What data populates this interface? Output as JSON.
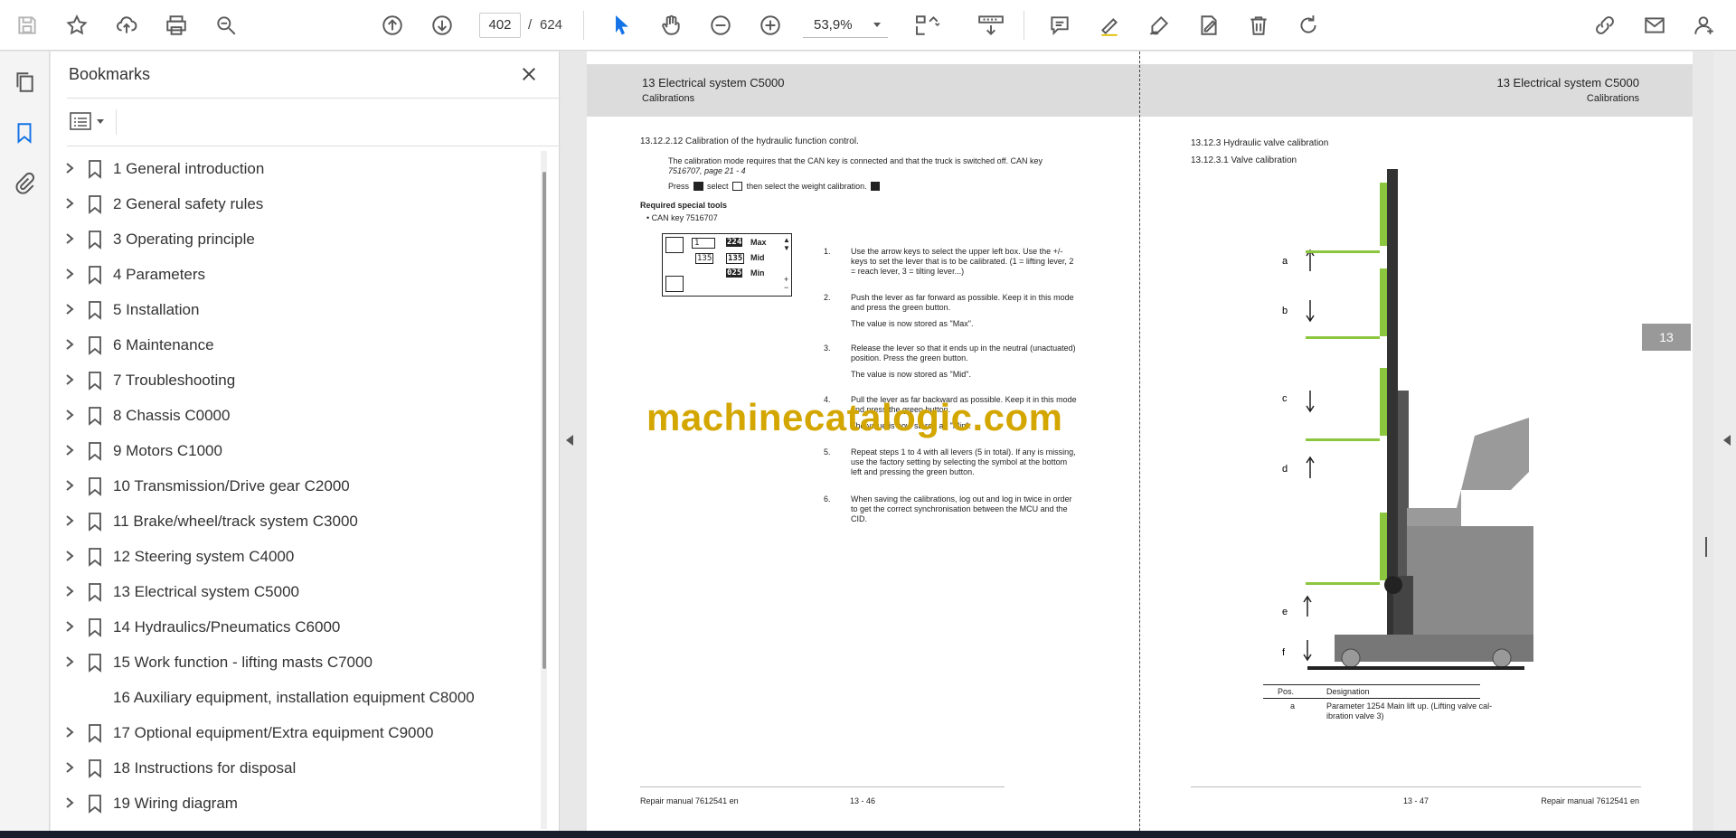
{
  "toolbar": {
    "current_page": "402",
    "page_sep": "/",
    "total_pages": "624",
    "zoom": "53,9%"
  },
  "panel": {
    "title": "Bookmarks",
    "bookmarks": [
      {
        "label": "1 General introduction",
        "expandable": true
      },
      {
        "label": "2 General safety rules",
        "expandable": true
      },
      {
        "label": "3 Operating principle",
        "expandable": true
      },
      {
        "label": "4 Parameters",
        "expandable": true
      },
      {
        "label": "5 Installation",
        "expandable": true
      },
      {
        "label": "6 Maintenance",
        "expandable": true
      },
      {
        "label": "7 Troubleshooting",
        "expandable": true
      },
      {
        "label": "8 Chassis C0000",
        "expandable": true
      },
      {
        "label": "9 Motors C1000",
        "expandable": true
      },
      {
        "label": "10 Transmission/Drive gear C2000",
        "expandable": true
      },
      {
        "label": "11 Brake/wheel/track system C3000",
        "expandable": true
      },
      {
        "label": "12 Steering system C4000",
        "expandable": true
      },
      {
        "label": "13 Electrical system C5000",
        "expandable": true
      },
      {
        "label": "14 Hydraulics/Pneumatics C6000",
        "expandable": true
      },
      {
        "label": "15 Work function - lifting masts C7000",
        "expandable": true
      },
      {
        "label": "16 Auxiliary equipment, installation equipment C8000",
        "expandable": false
      },
      {
        "label": "17 Optional equipment/Extra equipment C9000",
        "expandable": true
      },
      {
        "label": "18 Instructions for disposal",
        "expandable": true
      },
      {
        "label": "19 Wiring diagram",
        "expandable": true
      }
    ]
  },
  "left_page": {
    "header_title": "13 Electrical system C5000",
    "header_sub": "Calibrations",
    "section": "13.12.2.12 Calibration of the hydraulic function control.",
    "intro1": "The calibration mode requires that the CAN key is connected and that the truck is switched off. CAN key",
    "intro2": "7516707, page 21 - 4",
    "intro3": "Press",
    "intro3b": "select",
    "intro3c": "then select the weight calibration.",
    "tools_title": "Required special tools",
    "tools_item": "•  CAN key 7516707",
    "display": {
      "v1": "1",
      "v2": "224",
      "l2": "Max",
      "v3": "135",
      "v4": "135",
      "l4": "Mid",
      "v5": "025",
      "l5": "Min"
    },
    "steps": [
      {
        "num": "1.",
        "lines": [
          "Use the arrow keys to select the upper left box. Use the +/-",
          "keys to set the lever that is to be calibrated. (1 = lifting lever, 2",
          "= reach lever, 3 = tilting lever...)"
        ]
      },
      {
        "num": "2.",
        "lines": [
          "Push the lever as far forward as possible. Keep it in this mode",
          "and press the green button.",
          "",
          "The value is now stored as \"Max\"."
        ]
      },
      {
        "num": "3.",
        "lines": [
          "Release the lever so that it ends up in the neutral (unactuated)",
          "position. Press the green button.",
          "",
          "The value is now stored as \"Mid\"."
        ]
      },
      {
        "num": "4.",
        "lines": [
          "Pull the lever as far backward as possible. Keep it in this mode",
          "and press the green button.",
          "",
          "The value is now stored as \"Min\"."
        ]
      },
      {
        "num": "5.",
        "lines": [
          "Repeat steps 1 to 4 with all levers (5 in total). If any is missing,",
          "use the factory setting by selecting the symbol at the bottom",
          "left and pressing the green button."
        ]
      },
      {
        "num": "6.",
        "lines": [
          "When saving the calibrations, log out and log in twice in order",
          "to get the correct synchronisation between the MCU and the",
          "CID."
        ]
      }
    ],
    "footer_left": "Repair manual 7612541 en",
    "footer_center": "13 - 46"
  },
  "right_page": {
    "header_title": "13 Electrical system C5000",
    "header_sub": "Calibrations",
    "section": "13.12.3 Hydraulic valve calibration",
    "subsection": "13.12.3.1 Valve calibration",
    "labels": [
      "a",
      "b",
      "c",
      "d",
      "e",
      "f"
    ],
    "table_head_pos": "Pos.",
    "table_head_des": "Designation",
    "table_row_pos": "a",
    "table_row_des1": "Parameter 1254 Main lift up. (Lifting valve cal-",
    "table_row_des2": "ibration valve 3)",
    "footer_center": "13 - 47",
    "footer_right": "Repair manual 7612541 en",
    "tab": "13"
  },
  "watermark": "machinecatalogic.com",
  "colors": {
    "accent": "#1473e6",
    "band": "#dcdcdc",
    "watermark": "#d4a600",
    "mast_green": "#8cc63f"
  }
}
